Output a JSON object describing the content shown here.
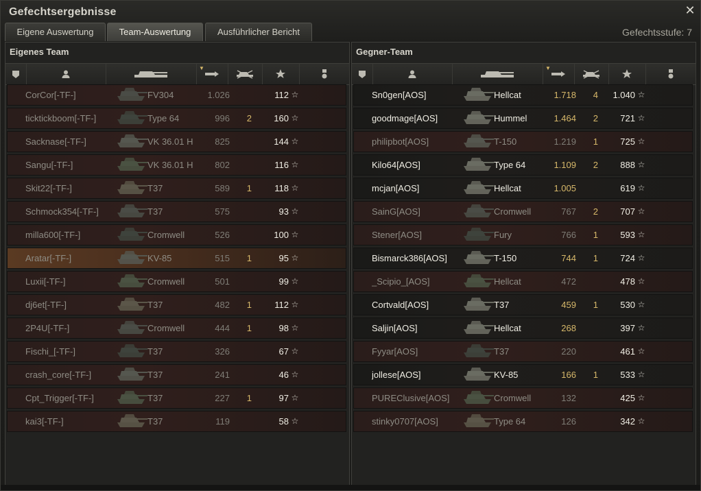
{
  "window": {
    "title": "Gefechtsergebnisse",
    "close_icon": "close-icon"
  },
  "tabs": [
    {
      "label": "Eigene Auswertung"
    },
    {
      "label": "Team-Auswertung"
    },
    {
      "label": "Ausführlicher Bericht"
    }
  ],
  "battle_tier": "Gefechtsstufe: 7",
  "colors": {
    "accent": "#d7b86a",
    "alive_text": "#f0eee4",
    "dead_text": "#8e8c84",
    "row_dead": "#301f1c",
    "row_self": "#5a3a22"
  },
  "icons": [
    "squad-icon",
    "player-icon",
    "tank-icon",
    "damage-icon",
    "kills-icon",
    "xp-star-icon",
    "medal-icon"
  ],
  "own_team": {
    "title": "Eigenes Team",
    "rows": [
      {
        "player": "CorCor[-TF-]",
        "tank": "FV304",
        "damage": "1.026",
        "kills": "",
        "xp": "112",
        "state": "dead",
        "dmg_level": "lo"
      },
      {
        "player": "ticktickboom[-TF-]",
        "tank": "Type 64",
        "damage": "996",
        "kills": "2",
        "xp": "160",
        "state": "dead",
        "dmg_level": "lo"
      },
      {
        "player": "Sacknase[-TF-]",
        "tank": "VK 36.01 H",
        "damage": "825",
        "kills": "",
        "xp": "144",
        "state": "dead",
        "dmg_level": "lo"
      },
      {
        "player": "Sangu[-TF-]",
        "tank": "VK 36.01 H",
        "damage": "802",
        "kills": "",
        "xp": "116",
        "state": "dead",
        "dmg_level": "lo"
      },
      {
        "player": "Skit22[-TF-]",
        "tank": "T37",
        "damage": "589",
        "kills": "1",
        "xp": "118",
        "state": "dead",
        "dmg_level": "lo"
      },
      {
        "player": "Schmock354[-TF-]",
        "tank": "T37",
        "damage": "575",
        "kills": "",
        "xp": "93",
        "state": "dead",
        "dmg_level": "lo"
      },
      {
        "player": "milla600[-TF-]",
        "tank": "Cromwell",
        "damage": "526",
        "kills": "",
        "xp": "100",
        "state": "dead",
        "dmg_level": "lo"
      },
      {
        "player": "Aratar[-TF-]",
        "tank": "KV-85",
        "damage": "515",
        "kills": "1",
        "xp": "95",
        "state": "me",
        "dmg_level": "lo"
      },
      {
        "player": "Luxii[-TF-]",
        "tank": "Cromwell",
        "damage": "501",
        "kills": "",
        "xp": "99",
        "state": "dead",
        "dmg_level": "lo"
      },
      {
        "player": "dj6et[-TF-]",
        "tank": "T37",
        "damage": "482",
        "kills": "1",
        "xp": "112",
        "state": "dead",
        "dmg_level": "lo"
      },
      {
        "player": "2P4U[-TF-]",
        "tank": "Cromwell",
        "damage": "444",
        "kills": "1",
        "xp": "98",
        "state": "dead",
        "dmg_level": "lo"
      },
      {
        "player": "Fischi_[-TF-]",
        "tank": "T37",
        "damage": "326",
        "kills": "",
        "xp": "67",
        "state": "dead",
        "dmg_level": "lo"
      },
      {
        "player": "crash_core[-TF-]",
        "tank": "T37",
        "damage": "241",
        "kills": "",
        "xp": "46",
        "state": "dead",
        "dmg_level": "lo"
      },
      {
        "player": "Cpt_Trigger[-TF-]",
        "tank": "T37",
        "damage": "227",
        "kills": "1",
        "xp": "97",
        "state": "dead",
        "dmg_level": "lo"
      },
      {
        "player": "kai3[-TF-]",
        "tank": "T37",
        "damage": "119",
        "kills": "",
        "xp": "58",
        "state": "dead",
        "dmg_level": "lo"
      }
    ]
  },
  "enemy_team": {
    "title": "Gegner-Team",
    "rows": [
      {
        "player": "Sn0gen[AOS]",
        "tank": "Hellcat",
        "damage": "1.718",
        "kills": "4",
        "xp": "1.040",
        "state": "alive",
        "dmg_level": "hi"
      },
      {
        "player": "goodmage[AOS]",
        "tank": "Hummel",
        "damage": "1.464",
        "kills": "2",
        "xp": "721",
        "state": "alive",
        "dmg_level": "hi"
      },
      {
        "player": "philipbot[AOS]",
        "tank": "T-150",
        "damage": "1.219",
        "kills": "1",
        "xp": "725",
        "state": "dead",
        "dmg_level": "lo"
      },
      {
        "player": "Kilo64[AOS]",
        "tank": "Type 64",
        "damage": "1.109",
        "kills": "2",
        "xp": "888",
        "state": "alive",
        "dmg_level": "hi"
      },
      {
        "player": "mcjan[AOS]",
        "tank": "Hellcat",
        "damage": "1.005",
        "kills": "",
        "xp": "619",
        "state": "alive",
        "dmg_level": "hi"
      },
      {
        "player": "SainG[AOS]",
        "tank": "Cromwell",
        "damage": "767",
        "kills": "2",
        "xp": "707",
        "state": "dead",
        "dmg_level": "lo"
      },
      {
        "player": "Stener[AOS]",
        "tank": "Fury",
        "damage": "766",
        "kills": "1",
        "xp": "593",
        "state": "dead",
        "dmg_level": "lo"
      },
      {
        "player": "Bismarck386[AOS]",
        "tank": "T-150",
        "damage": "744",
        "kills": "1",
        "xp": "724",
        "state": "alive",
        "dmg_level": "hi"
      },
      {
        "player": "_Scipio_[AOS]",
        "tank": "Hellcat",
        "damage": "472",
        "kills": "",
        "xp": "478",
        "state": "dead",
        "dmg_level": "lo"
      },
      {
        "player": "Cortvald[AOS]",
        "tank": "T37",
        "damage": "459",
        "kills": "1",
        "xp": "530",
        "state": "alive",
        "dmg_level": "hi"
      },
      {
        "player": "Saljin[AOS]",
        "tank": "Hellcat",
        "damage": "268",
        "kills": "",
        "xp": "397",
        "state": "alive",
        "dmg_level": "hi"
      },
      {
        "player": "Fyyar[AOS]",
        "tank": "T37",
        "damage": "220",
        "kills": "",
        "xp": "461",
        "state": "dead",
        "dmg_level": "lo"
      },
      {
        "player": "jollese[AOS]",
        "tank": "KV-85",
        "damage": "166",
        "kills": "1",
        "xp": "533",
        "state": "alive",
        "dmg_level": "hi"
      },
      {
        "player": "PUREClusive[AOS]",
        "tank": "Cromwell",
        "damage": "132",
        "kills": "",
        "xp": "425",
        "state": "dead",
        "dmg_level": "lo"
      },
      {
        "player": "stinky0707[AOS]",
        "tank": "Type 64",
        "damage": "126",
        "kills": "",
        "xp": "342",
        "state": "dead",
        "dmg_level": "lo"
      }
    ]
  }
}
